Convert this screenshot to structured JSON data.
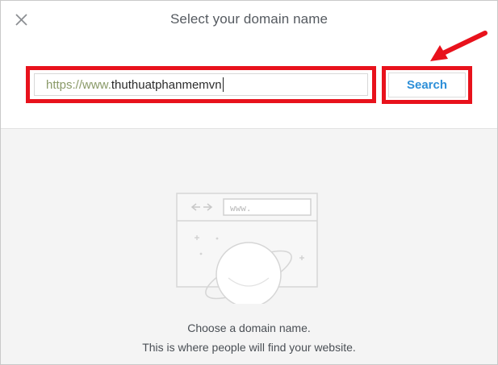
{
  "dialog": {
    "title": "Select your domain name",
    "close_icon": "close-icon"
  },
  "domain": {
    "prefix": "https://www.",
    "value": "thuthuatphanmemvn"
  },
  "search": {
    "label": "Search"
  },
  "illustration": {
    "url_text": "www.",
    "nav_icons": [
      "back-arrow-icon",
      "forward-arrow-icon"
    ]
  },
  "empty_state": {
    "line1": "Choose a domain name.",
    "line2": "This is where people will find your website."
  },
  "colors": {
    "highlight": "#e8121c",
    "accent": "#2d8fd8",
    "prefix_text": "#8a9a68",
    "panel_background": "#f4f4f4"
  }
}
